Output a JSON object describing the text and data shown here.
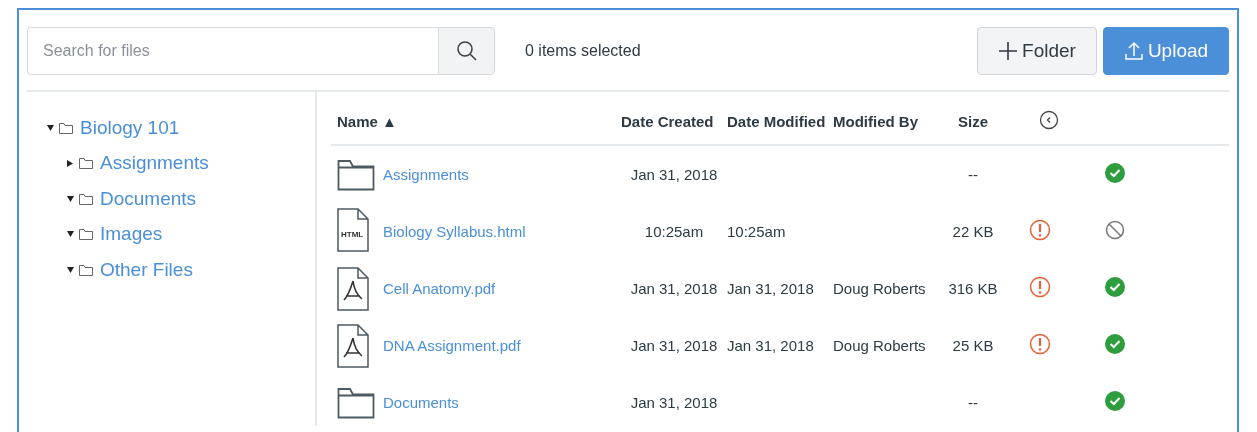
{
  "toolbar": {
    "search": {
      "placeholder": "Search for files"
    },
    "selection_count": "0 items selected",
    "buttons": [
      {
        "kind": "folder",
        "label": "Folder"
      },
      {
        "kind": "upload",
        "label": "Upload"
      }
    ]
  },
  "tree": [
    {
      "label": "Biology 101",
      "expanded": true,
      "children": [
        {
          "label": "Assignments",
          "expanded": false
        },
        {
          "label": "Documents",
          "expanded": true
        },
        {
          "label": "Images",
          "expanded": true
        },
        {
          "label": "Other Files",
          "expanded": true
        }
      ]
    }
  ],
  "table": {
    "columns": [
      {
        "label": "Name",
        "sort_arrow": "▲"
      },
      {
        "label": "Date Created"
      },
      {
        "label": "Date Modified"
      },
      {
        "label": "Modified By"
      },
      {
        "label": "Size"
      }
    ],
    "rows": [
      {
        "kind": "folder",
        "name": "Assignments",
        "date_created": "Jan 31, 2018",
        "size": "--",
        "warning": false,
        "published": true
      },
      {
        "kind": "html",
        "icon_text": "HTML",
        "name": "Biology Syllabus.html",
        "date_created": "10:25am",
        "date_modified": "10:25am",
        "size": "22 KB",
        "warning": true,
        "published": false
      },
      {
        "kind": "pdf",
        "name": "Cell Anatomy.pdf",
        "date_created": "Jan 31, 2018",
        "date_modified": "Jan 31, 2018",
        "modified_by": "Doug Roberts",
        "size": "316 KB",
        "warning": true,
        "published": true
      },
      {
        "kind": "pdf",
        "name": "DNA Assignment.pdf",
        "date_created": "Jan 31, 2018",
        "date_modified": "Jan 31, 2018",
        "modified_by": "Doug Roberts",
        "size": "25 KB",
        "warning": true,
        "published": true
      },
      {
        "kind": "folder",
        "name": "Documents",
        "date_created": "Jan 31, 2018",
        "size": "--",
        "warning": false,
        "published": true
      }
    ]
  }
}
